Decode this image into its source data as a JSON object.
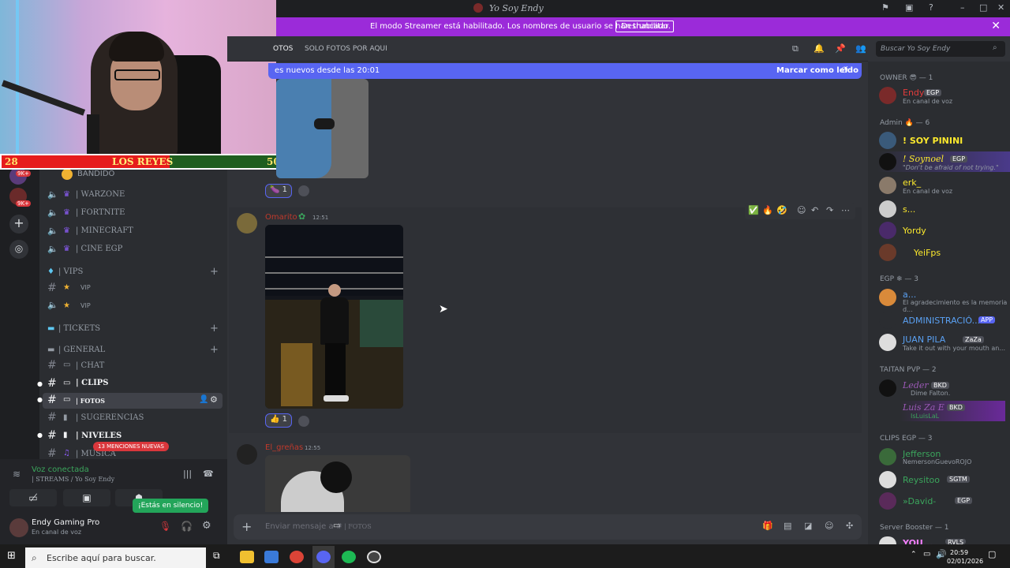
{
  "window": {
    "title": "Yo Soy Endy"
  },
  "banner": {
    "message": "El modo Streamer está habilitado. Los nombres de usuario se han truncado.",
    "button": "Deshabilitar"
  },
  "stream_overlay": {
    "left_score": "28",
    "team_name": "LOS REYES",
    "right_score": "50"
  },
  "rail": {
    "badge1": "9K+",
    "badge2": "9K+"
  },
  "channels": {
    "top_partial": "BANDIDO",
    "voice": [
      "| WARZONE",
      "| FORTNITE",
      "| MINECRAFT",
      "| CINE EGP"
    ],
    "vips_cat": "| VIPS",
    "vips": [
      "VIP",
      "VIP"
    ],
    "tickets_cat": "| TICKETS",
    "general_cat": "| GENERAL",
    "general": [
      "| CHAT",
      "| CLIPS",
      "| FOTOS",
      "| SUGERENCIAS",
      "| NIVELES",
      "| MUSICA"
    ],
    "mentions_pill": "13 MENCIONES NUEVAS"
  },
  "voice_panel": {
    "status": "Voz conectada",
    "channel": "| STREAMS / Yo Soy Endy",
    "silence_tip": "¡Estás en silencio!"
  },
  "user_panel": {
    "name": "Endy Gaming Pro",
    "status": "En canal de voz"
  },
  "header": {
    "tab_left": "OTOS",
    "tab": "SOLO FOTOS POR AQUI",
    "search_placeholder": "Buscar Yo Soy Endy"
  },
  "newbar": {
    "text": "es nuevos desde las 20:01",
    "mark": "Marcar como leído"
  },
  "messages": [
    {
      "author": "",
      "time": "",
      "reaction": "1"
    },
    {
      "author": "Omarito",
      "time": "12:51",
      "reaction": "1"
    },
    {
      "author": "El_greñas",
      "time": "12:55",
      "reaction": ""
    }
  ],
  "composer": {
    "placeholder": "Enviar mensaje a #",
    "channel": "| FOTOS"
  },
  "members": {
    "owner_head": "OWNER",
    "owner_count": "— 1",
    "owner": [
      {
        "name": "Endy",
        "tag": "EGP",
        "sub": "En canal de voz",
        "color": "#e23c3c"
      }
    ],
    "admin_head": "Admin",
    "admin_count": "— 6",
    "admins": [
      {
        "name": "! SOY PININI",
        "sub": "",
        "color": "#fce92d"
      },
      {
        "name": "! Soynoel",
        "tag": "EGP",
        "sub": "\"Don't be afraid of not trying.\"",
        "color": "#fce92d"
      },
      {
        "name": "erk_",
        "sub": "En canal de voz",
        "color": "#fce92d"
      },
      {
        "name": "s...",
        "sub": "",
        "color": "#fce92d"
      },
      {
        "name": "Yordy",
        "sub": "",
        "color": "#fce92d"
      },
      {
        "name": "YeiFps",
        "sub": "",
        "color": "#fce92d"
      }
    ],
    "egp_head": "EGP",
    "egp_count": "— 3",
    "egp": [
      {
        "name": "a...",
        "sub": "El agradecimiento es la memoria d...",
        "color": "#5aa0f2"
      },
      {
        "name": "ADMINISTRACIÓ...",
        "tag": "APP",
        "sub": "",
        "color": "#5aa0f2"
      },
      {
        "name": "JUAN PILA",
        "tag": "ZaZa",
        "sub": "Take it out with your mouth an...",
        "color": "#5aa0f2"
      }
    ],
    "taitan_head": "TAITAN PVP",
    "taitan_count": "— 2",
    "taitan": [
      {
        "name": "Leder",
        "tag": "BKD",
        "sub": "Dime Falton.",
        "color": "#9b59b6"
      },
      {
        "name": "Luis Za E",
        "tag": "BKD",
        "sub": "IsLuisLaL",
        "color": "#9b59b6"
      }
    ],
    "clips_head": "CLIPS EGP",
    "clips_count": "— 3",
    "clips": [
      {
        "name": "Jefferson",
        "sub": "NemersonGuevoROJO",
        "color": "#3ba55c"
      },
      {
        "name": "Reysitoo",
        "tag": "SGTM",
        "sub": "",
        "color": "#3ba55c"
      },
      {
        "name": "»David-",
        "tag": "EGP",
        "sub": "",
        "color": "#3ba55c"
      }
    ],
    "booster_head": "Server Booster",
    "booster_count": "— 1",
    "booster": [
      {
        "name": "YOU...",
        "tag": "RVLS",
        "sub": "",
        "color": "#f47fff"
      }
    ]
  },
  "taskbar": {
    "search": "Escribe aquí para buscar.",
    "time": "20:59",
    "date": "02/01/2026"
  }
}
